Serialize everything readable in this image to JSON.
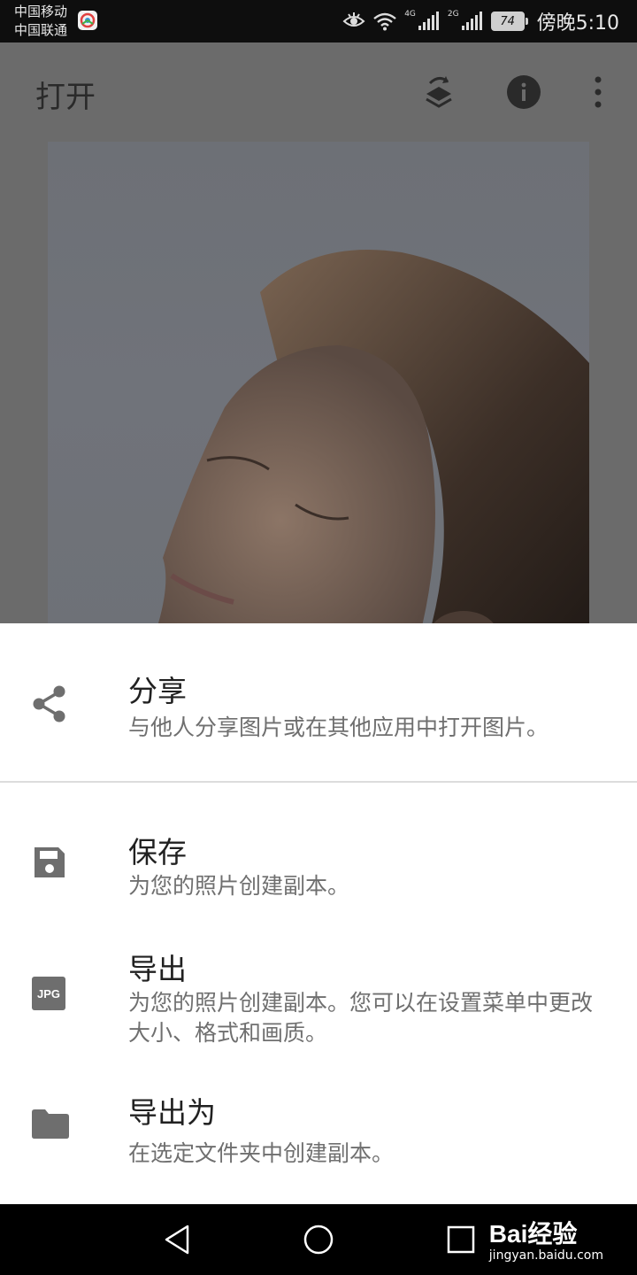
{
  "status_bar": {
    "carrier_1": "中国移动",
    "carrier_2": "中国联通",
    "network_1": "4G",
    "network_2": "2G",
    "battery": "74",
    "time": "傍晚5:10"
  },
  "toolbar": {
    "title": "打开"
  },
  "share_sheet": {
    "items": [
      {
        "icon": "share-icon",
        "title": "分享",
        "description": "与他人分享图片或在其他应用中打开图片。"
      },
      {
        "icon": "save-icon",
        "title": "保存",
        "description": "为您的照片创建副本。"
      },
      {
        "icon": "jpg-icon",
        "icon_text": "JPG",
        "title": "导出",
        "description": "为您的照片创建副本。您可以在设置菜单中更改大小、格式和画质。"
      },
      {
        "icon": "folder-icon",
        "title": "导出为",
        "description": "在选定文件夹中创建副本。"
      }
    ]
  },
  "watermark": {
    "logo": "Bai经验",
    "url": "jingyan.baidu.com"
  },
  "colors": {
    "scrim": "#6b6b6b",
    "sheet_bg": "#ffffff",
    "title_text": "#212121",
    "desc_text": "#6f6f6f",
    "icon_gray": "#6e6e6e"
  }
}
